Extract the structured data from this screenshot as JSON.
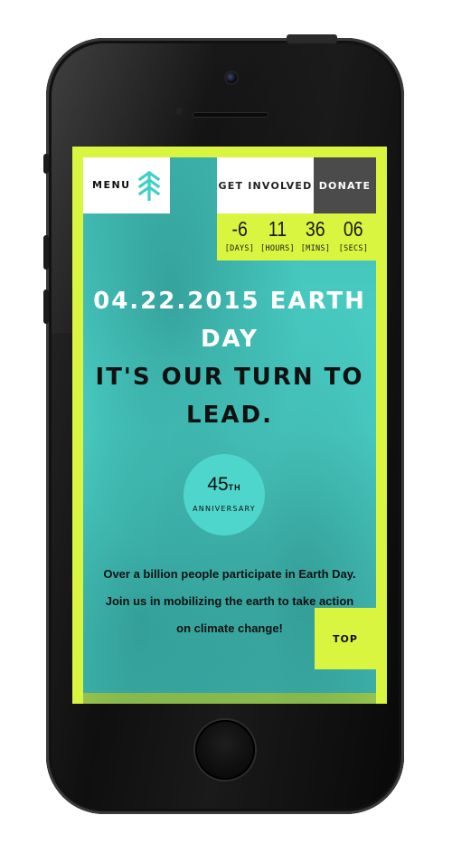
{
  "header": {
    "menu_label": "MENU",
    "logo_icon": "tree-logo-icon",
    "get_involved_label": "GET INVOLVED",
    "donate_label": "DONATE"
  },
  "countdown": [
    {
      "value": "-6",
      "label": "[DAYS]"
    },
    {
      "value": "11",
      "label": "[HOURS]"
    },
    {
      "value": "36",
      "label": "[MINS]"
    },
    {
      "value": "06",
      "label": "[SECS]"
    }
  ],
  "hero": {
    "date_line_1": "04.22.2015 EARTH",
    "date_line_2": "DAY",
    "tagline_1": "IT'S OUR TURN TO",
    "tagline_2": "LEAD."
  },
  "badge": {
    "number": "45",
    "suffix": "TH",
    "label": "ANNIVERSARY"
  },
  "body": {
    "line_1": "Over a billion people participate in Earth Day.",
    "line_2": "Join us in mobilizing the earth to take action",
    "line_3": "on climate change!"
  },
  "top_button_label": "TOP",
  "colors": {
    "teal": "#4ed6cc",
    "lime": "#d9f53f",
    "dark_gray": "#4b4b4b",
    "white": "#ffffff"
  }
}
